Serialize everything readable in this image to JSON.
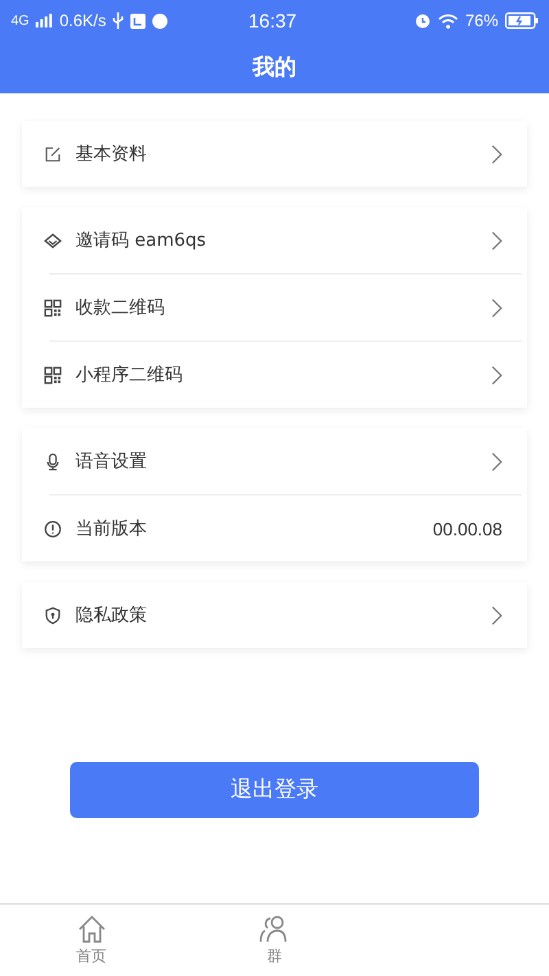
{
  "status_bar": {
    "network": "4G",
    "speed": "0.6K/s",
    "time": "16:37",
    "battery": "76%"
  },
  "header": {
    "title": "我的"
  },
  "groups": [
    {
      "rows": [
        {
          "kind": "link",
          "label": "基本资料"
        }
      ]
    },
    {
      "rows": [
        {
          "kind": "link",
          "label": "邀请码 eam6qs"
        },
        {
          "kind": "link",
          "label": "收款二维码"
        },
        {
          "kind": "link",
          "label": "小程序二维码"
        }
      ]
    },
    {
      "rows": [
        {
          "kind": "link",
          "label": "语音设置"
        },
        {
          "kind": "value",
          "label": "当前版本",
          "value": "00.00.08"
        }
      ]
    },
    {
      "rows": [
        {
          "kind": "link",
          "label": "隐私政策"
        }
      ]
    }
  ],
  "logout_button": "退出登录",
  "tab_bar": [
    {
      "label": "首页"
    },
    {
      "label": "群"
    }
  ]
}
